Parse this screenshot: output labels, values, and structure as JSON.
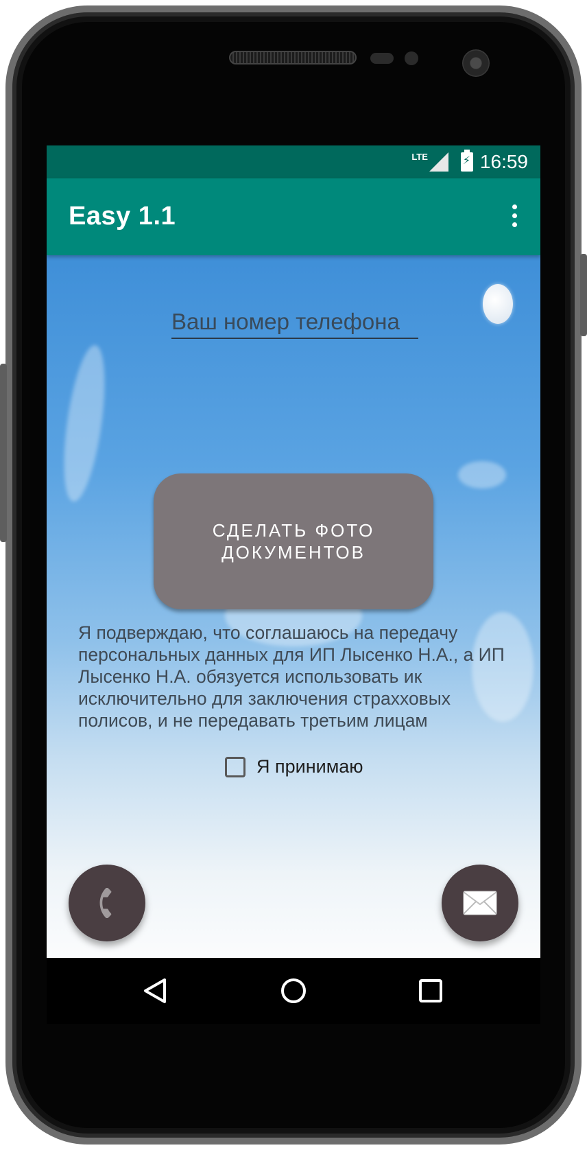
{
  "status_bar": {
    "network": "LTE",
    "time": "16:59"
  },
  "app_bar": {
    "title": "Easy 1.1",
    "menu_icon": "more-vert-icon"
  },
  "form": {
    "phone_placeholder": "Ваш номер телефона",
    "photo_button_label": "СДЕЛАТЬ ФОТО ДОКУМЕНТОВ",
    "consent_text": "Я подверждаю, что соглашаюсь на передачу персональных данных для ИП Лысенко Н.А., а ИП Лысенко Н.А. обязуется использовать ик исключительно для заключения страхховых полисов, и не передавать третьим лицам",
    "accept_label": "Я принимаю",
    "accept_checked": false
  },
  "fabs": {
    "call_icon": "phone-icon",
    "mail_icon": "mail-icon"
  },
  "nav": {
    "back_icon": "back-icon",
    "home_icon": "home-icon",
    "recent_icon": "recent-apps-icon"
  },
  "colors": {
    "status_bar": "#00695c",
    "app_bar": "#00897b",
    "photo_button": "#7d7679",
    "fab": "#4a3e42"
  }
}
